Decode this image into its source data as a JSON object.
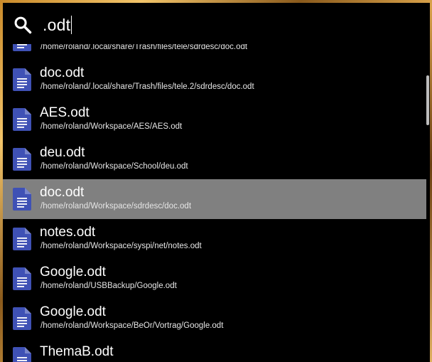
{
  "search": {
    "query": ".odt",
    "icon": "search-icon"
  },
  "results": [
    {
      "name": "",
      "path": "/home/roland/.local/share/Trash/files/tele/sdrdesc/doc.odt",
      "icon": "document-icon",
      "selected": false
    },
    {
      "name": "doc.odt",
      "path": "/home/roland/.local/share/Trash/files/tele.2/sdrdesc/doc.odt",
      "icon": "document-icon",
      "selected": false
    },
    {
      "name": "AES.odt",
      "path": "/home/roland/Workspace/AES/AES.odt",
      "icon": "document-icon",
      "selected": false
    },
    {
      "name": "deu.odt",
      "path": "/home/roland/Workspace/School/deu.odt",
      "icon": "document-icon",
      "selected": false
    },
    {
      "name": "doc.odt",
      "path": "/home/roland/Workspace/sdrdesc/doc.odt",
      "icon": "document-icon",
      "selected": true
    },
    {
      "name": "notes.odt",
      "path": "/home/roland/Workspace/syspi/net/notes.odt",
      "icon": "document-icon",
      "selected": false
    },
    {
      "name": "Google.odt",
      "path": "/home/roland/USBBackup/Google.odt",
      "icon": "document-icon",
      "selected": false
    },
    {
      "name": "Google.odt",
      "path": "/home/roland/Workspace/BeOr/Vortrag/Google.odt",
      "icon": "document-icon",
      "selected": false
    },
    {
      "name": "ThemaB.odt",
      "path": "",
      "icon": "document-icon",
      "selected": false
    }
  ],
  "colors": {
    "background": "#000000",
    "selected_row": "#808080",
    "doc_icon": "#3f51b5",
    "doc_icon_fold": "#7986cb",
    "text": "#ffffff"
  }
}
